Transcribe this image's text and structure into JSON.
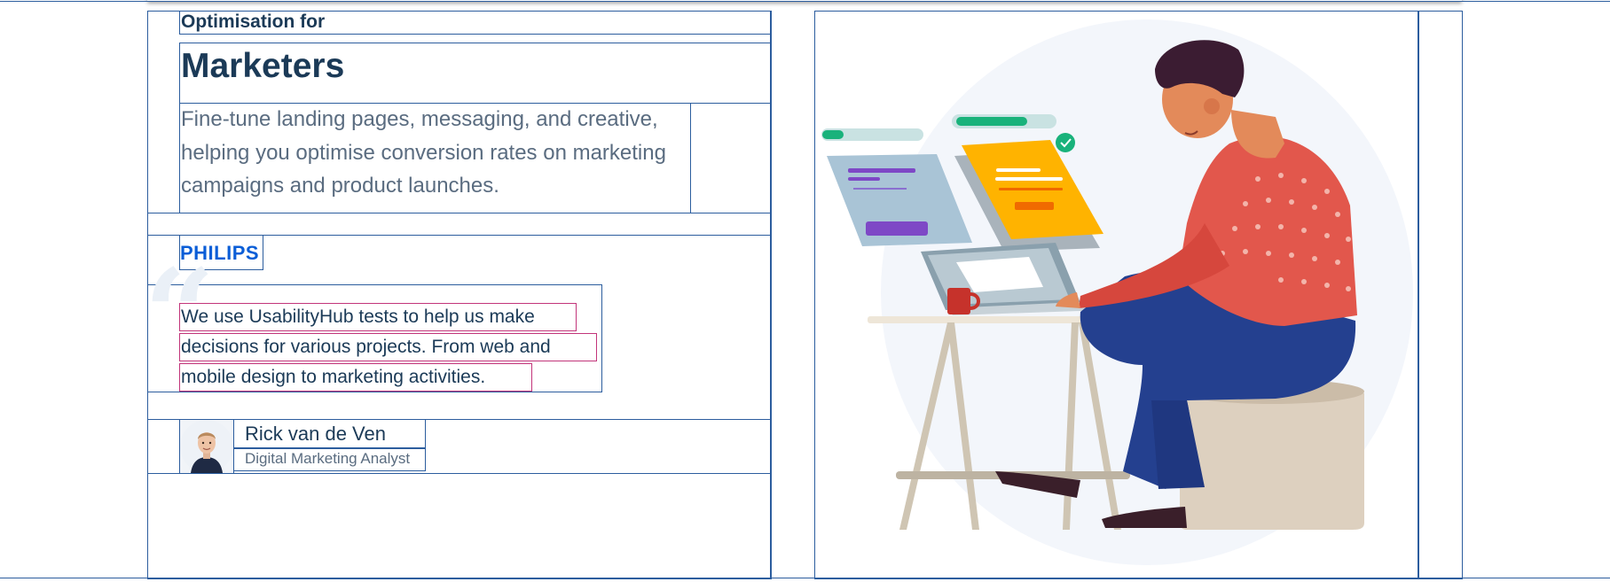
{
  "section": {
    "eyebrow": "Optimisation for",
    "title": "Marketers",
    "description": "Fine-tune landing pages, messaging, and creative, helping you optimise conversion rates on marketing campaigns and product launches."
  },
  "testimonial": {
    "brand": "PHILIPS",
    "quote_lines": [
      "We use UsabilityHub tests to help us make",
      "decisions for various projects. From web and",
      "mobile design to marketing activities."
    ],
    "author_name": "Rick van de Ven",
    "author_role": "Digital Marketing Analyst"
  },
  "colors": {
    "heading": "#1b3a57",
    "body": "#5a6c80",
    "brand": "#0b5ed7",
    "outline": "#2c5d9e",
    "highlight_outline": "#c2357a",
    "shirt": "#e2574c",
    "jeans": "#24408f",
    "card_yellow": "#ffb300"
  },
  "illustration": {
    "name": "person-at-laptop-illustration"
  }
}
